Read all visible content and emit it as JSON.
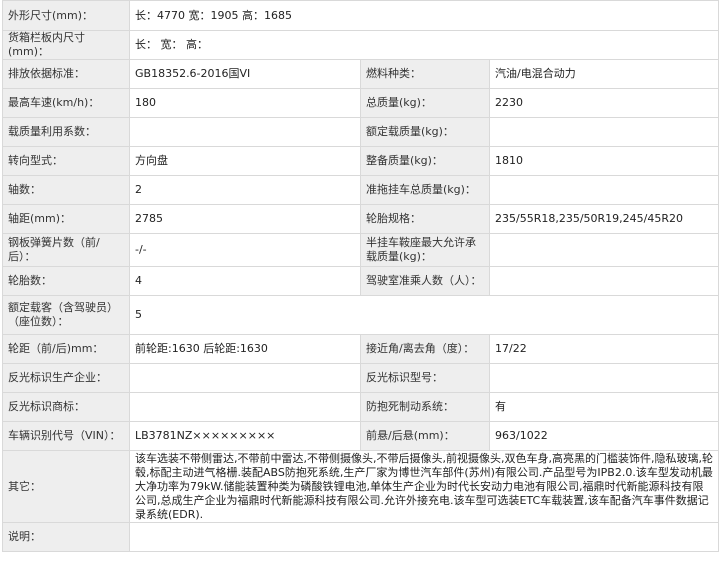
{
  "rows": [
    {
      "l1": "外形尺寸(mm)：",
      "v1": "长：4770 宽：1905 高：1685",
      "full": true
    },
    {
      "l1": "货箱栏板内尺寸(mm)：",
      "v1": "长： 宽： 高：",
      "full": true
    },
    {
      "l1": "排放依据标准：",
      "v1": "GB18352.6-2016国VI",
      "l2": "燃料种类：",
      "v2": "汽油/电混合动力"
    },
    {
      "l1": "最高车速(km/h)：",
      "v1": "180",
      "l2": "总质量(kg)：",
      "v2": "2230"
    },
    {
      "l1": "载质量利用系数：",
      "v1": "",
      "l2": "额定载质量(kg)：",
      "v2": ""
    },
    {
      "l1": "转向型式：",
      "v1": "方向盘",
      "l2": "整备质量(kg)：",
      "v2": "1810"
    },
    {
      "l1": "轴数：",
      "v1": "2",
      "l2": "准拖挂车总质量(kg)：",
      "v2": ""
    },
    {
      "l1": "轴距(mm)：",
      "v1": "2785",
      "l2": "轮胎规格：",
      "v2": "235/55R18,235/50R19,245/45R20"
    },
    {
      "l1": "钢板弹簧片数（前/后）：",
      "v1": "-/-",
      "l2": "半挂车鞍座最大允许承载质量(kg)：",
      "v2": ""
    },
    {
      "l1": "轮胎数：",
      "v1": "4",
      "l2": "驾驶室准乘人数（人）：",
      "v2": ""
    },
    {
      "l1": "额定载客（含驾驶员）（座位数）：",
      "v1": "5",
      "full": true
    },
    {
      "l1": "轮距（前/后)mm：",
      "v1": "前轮距:1630 后轮距:1630",
      "l2": "接近角/离去角（度）：",
      "v2": "17/22"
    },
    {
      "l1": "反光标识生产企业：",
      "v1": "",
      "l2": "反光标识型号：",
      "v2": ""
    },
    {
      "l1": "反光标识商标：",
      "v1": "",
      "l2": "防抱死制动系统：",
      "v2": "有"
    },
    {
      "l1": "车辆识别代号（VIN）：",
      "v1": "LB3781NZ×××××××××",
      "l2": "前悬/后悬(mm)：",
      "v2": "963/1022"
    },
    {
      "l1": "其它：",
      "v1": "该车选装不带侧雷达,不带前中雷达,不带侧摄像头,不带后摄像头,前视摄像头,双色车身,高亮黑的门槛装饰件,隐私玻璃,轮毂,标配主动进气格栅.装配ABS防抱死系统,生产厂家为博世汽车部件(苏州)有限公司.产品型号为IPB2.0.该车型发动机最大净功率为79kW.储能装置种类为磷酸铁锂电池,单体生产企业为时代长安动力电池有限公司,福鼎时代新能源科技有限公司,总成生产企业为福鼎时代新能源科技有限公司.允许外接充电.该车型可选装ETC车载装置,该车配备汽车事件数据记录系统(EDR).",
      "full": true,
      "desc": true
    },
    {
      "l1": "说明：",
      "v1": "",
      "full": true
    }
  ]
}
